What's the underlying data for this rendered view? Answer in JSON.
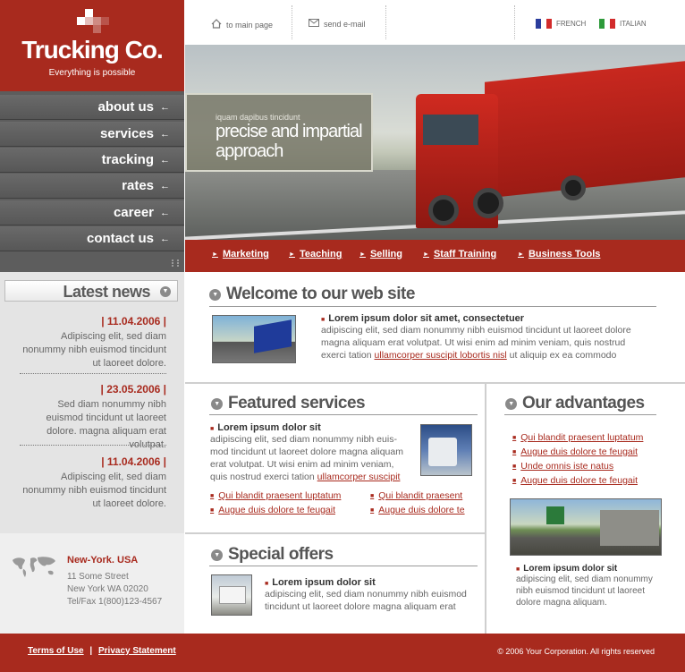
{
  "logo": {
    "name": "Trucking Co.",
    "tagline": "Everything is possible"
  },
  "topbar": {
    "home_link": "to main page",
    "email_link": "send e-mail",
    "lang_fr": "FRENCH",
    "lang_it": "ITALIAN"
  },
  "hero": {
    "small": "iquam dapibus tincidunt",
    "big": "precise and impartial approach"
  },
  "nav": {
    "items": [
      {
        "label": "about us"
      },
      {
        "label": "services"
      },
      {
        "label": "tracking"
      },
      {
        "label": "rates"
      },
      {
        "label": "career"
      },
      {
        "label": "contact us"
      }
    ],
    "arrow": "←"
  },
  "subnav": {
    "items": [
      "Marketing",
      "Teaching",
      "Selling",
      "Staff Training",
      "Business Tools"
    ]
  },
  "news": {
    "title": "Latest news",
    "items": [
      {
        "date": "| 11.04.2006 |",
        "text": "Adipiscing elit, sed diam nonummy nibh euismod tincidunt ut laoreet dolore."
      },
      {
        "date": "| 23.05.2006 |",
        "text": "Sed diam nonummy nibh euismod tincidunt ut laoreet dolore. magna aliquam erat volutpat."
      },
      {
        "date": "| 11.04.2006 |",
        "text": "Adipiscing elit, sed diam nonummy nibh euismod tincidunt ut laoreet dolore."
      }
    ]
  },
  "address": {
    "city": "New-York. USA",
    "line1": "11 Some Street",
    "line2": "New York WA 02020",
    "line3": "Tel/Fax 1(800)123-4567"
  },
  "welcome": {
    "title": "Welcome to our web site",
    "bullet": "Lorem ipsum dolor sit amet, consectetuer",
    "text": "adipiscing elit, sed diam nonummy nibh euismod tincidunt ut laoreet dolore magna aliquam erat volutpat. Ut wisi enim ad minim veniam, quis nostrud exerci tation ",
    "link": "ullamcorper suscipit lobortis nisl",
    "text_end": " ut aliquip ex ea commodo"
  },
  "featured": {
    "title": "Featured services",
    "bullet": "Lorem ipsum dolor sit",
    "text": "adipiscing elit, sed diam nonummy nibh euis-mod tincidunt ut laoreet dolore magna aliquam erat volutpat. Ut wisi enim ad minim veniam, quis nostrud exerci tation ",
    "link": "ullamcorper suscipit",
    "links": [
      "Qui blandit praesent luptatum",
      "Qui blandit praesent",
      "Augue duis dolore te feugait",
      "Augue duis dolore te"
    ]
  },
  "special": {
    "title": "Special offers",
    "bullet": "Lorem ipsum dolor sit",
    "text": "adipiscing elit, sed diam nonummy nibh euismod tincidunt ut laoreet dolore magna aliquam erat"
  },
  "advantages": {
    "title": "Our advantages",
    "links": [
      "Qui blandit praesent luptatum",
      "Augue duis dolore te feugait",
      "Unde omnis iste natus",
      "Augue duis dolore te feugait"
    ],
    "bullet": "Lorem ipsum dolor sit",
    "text": "adipiscing elit, sed diam nonummy nibh euismod tincidunt ut laoreet dolore magna aliquam."
  },
  "footer": {
    "terms": "Terms of Use",
    "sep": "|",
    "privacy": "Privacy Statement",
    "copyright": "© 2006 Your Corporation. All rights reserved"
  },
  "colors": {
    "brand": "#a82a1e",
    "nav": "#5d5d5d",
    "sidebar": "#e4e4e4"
  }
}
